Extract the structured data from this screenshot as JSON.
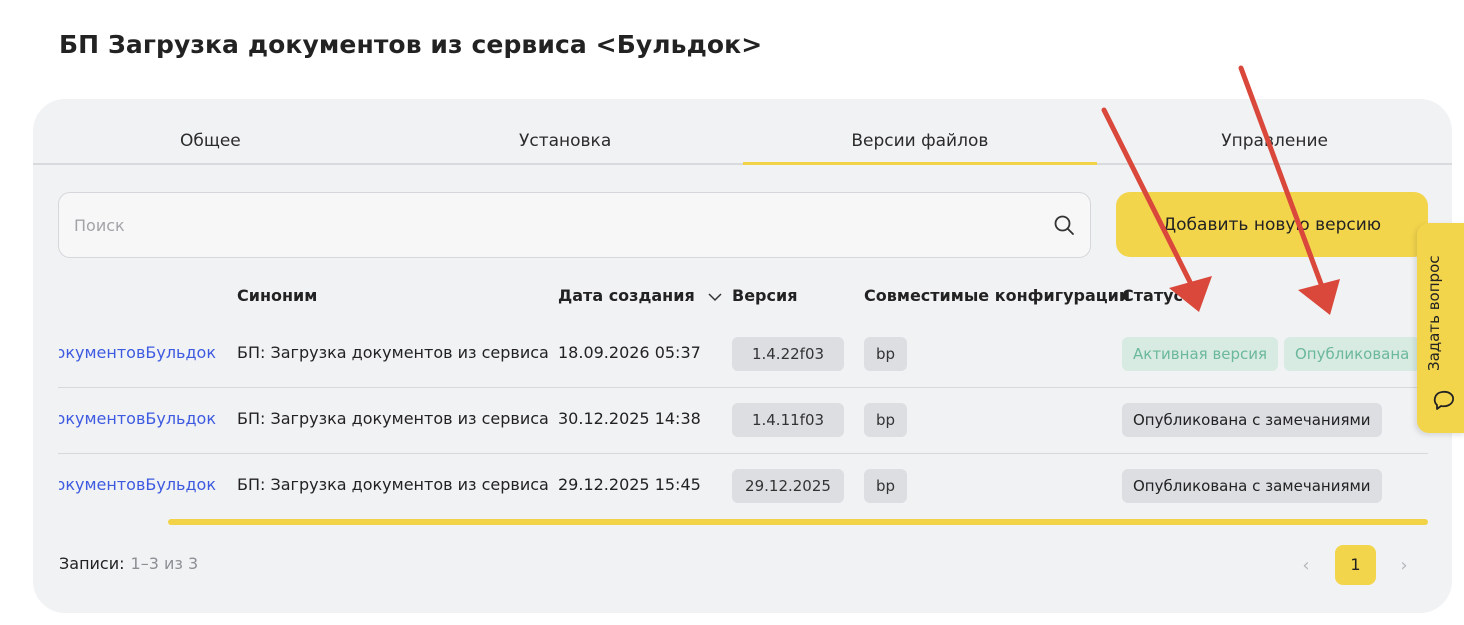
{
  "page_title": "БП Загрузка документов из сервиса <Бульдок>",
  "tabs": [
    {
      "label": "Общее",
      "active": false
    },
    {
      "label": "Установка",
      "active": false
    },
    {
      "label": "Версии файлов",
      "active": true
    },
    {
      "label": "Управление",
      "active": false
    }
  ],
  "search": {
    "placeholder": "Поиск",
    "value": ""
  },
  "add_button": "Добавить новую версию",
  "table": {
    "headers": {
      "synonym": "Синоним",
      "created": "Дата создания",
      "version": "Версия",
      "configs": "Совместимые конфигурации",
      "status": "Статус"
    },
    "rows": [
      {
        "name": "ЗагрузкаДокументовБульдок",
        "synonym": "БП: Загрузка документов из сервиса",
        "date": "18.09.2026 05:37",
        "version": "1.4.22f03",
        "config": "bp",
        "statuses": [
          {
            "label": "Активная версия",
            "kind": "green"
          },
          {
            "label": "Опубликована",
            "kind": "green"
          }
        ]
      },
      {
        "name": "ЗагрузкаДокументовБульдок",
        "synonym": "БП: Загрузка документов из сервиса",
        "date": "30.12.2025 14:38",
        "version": "1.4.11f03",
        "config": "bp",
        "statuses": [
          {
            "label": "Опубликована с замечаниями",
            "kind": "gray"
          }
        ]
      },
      {
        "name": "ЗагрузкаДокументовБульдок",
        "synonym": "БП: Загрузка документов из сервиса",
        "date": "29.12.2025 15:45",
        "version": "29.12.2025",
        "config": "bp",
        "statuses": [
          {
            "label": "Опубликована с замечаниями",
            "kind": "gray"
          }
        ]
      }
    ]
  },
  "footer": {
    "records_label": "Записи:",
    "records_range": "1–3 из 3"
  },
  "pagination": {
    "current_page": "1",
    "prev": "‹",
    "next": "›"
  },
  "side_tab": {
    "label": "Задать вопрос"
  },
  "annotations": {
    "arrow_color": "#d9483b"
  },
  "colors": {
    "accent": "#f3d54c",
    "link": "#3d5ae0",
    "card_bg": "#f1f2f4"
  }
}
